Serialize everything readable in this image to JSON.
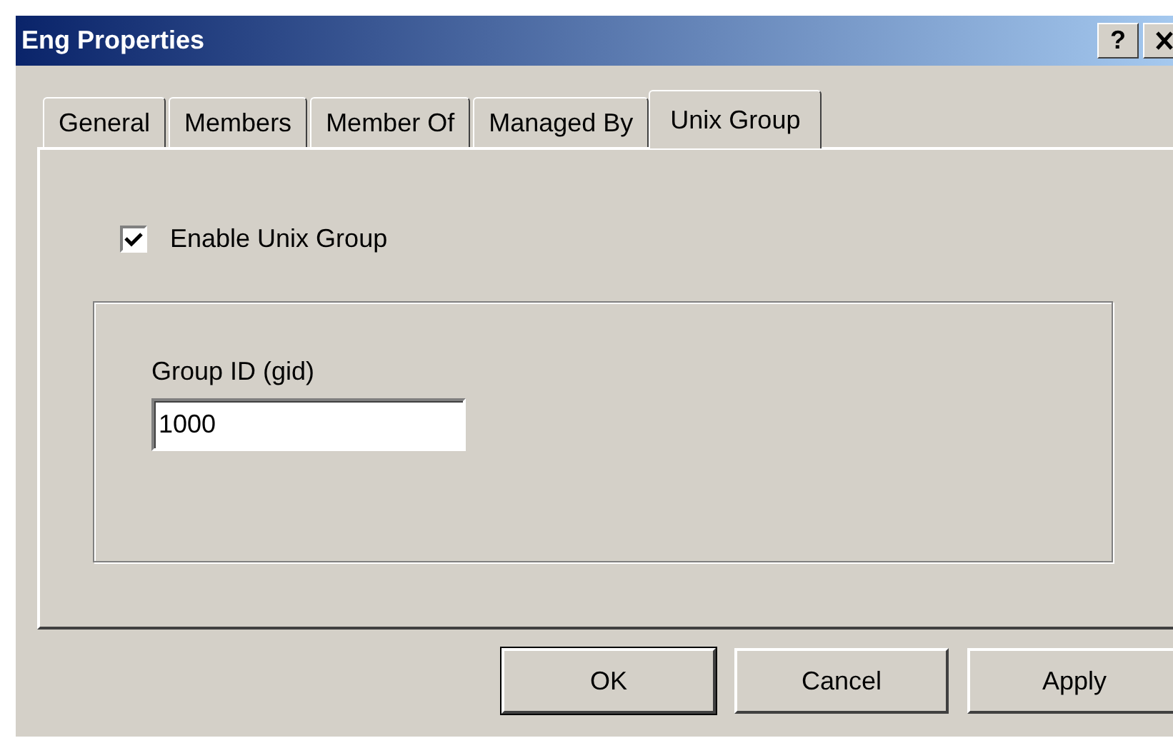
{
  "window": {
    "title": "Eng Properties",
    "help": "?"
  },
  "tabs": [
    {
      "label": "General",
      "selected": false
    },
    {
      "label": "Members",
      "selected": false
    },
    {
      "label": "Member Of",
      "selected": false
    },
    {
      "label": "Managed By",
      "selected": false
    },
    {
      "label": "Unix Group",
      "selected": true
    }
  ],
  "enable_checkbox": {
    "label": "Enable Unix Group",
    "checked": true
  },
  "group_id": {
    "label": "Group ID (gid)",
    "value": "1000"
  },
  "buttons": [
    {
      "label": "OK",
      "default": true
    },
    {
      "label": "Cancel",
      "default": false
    },
    {
      "label": "Apply",
      "default": false
    }
  ]
}
